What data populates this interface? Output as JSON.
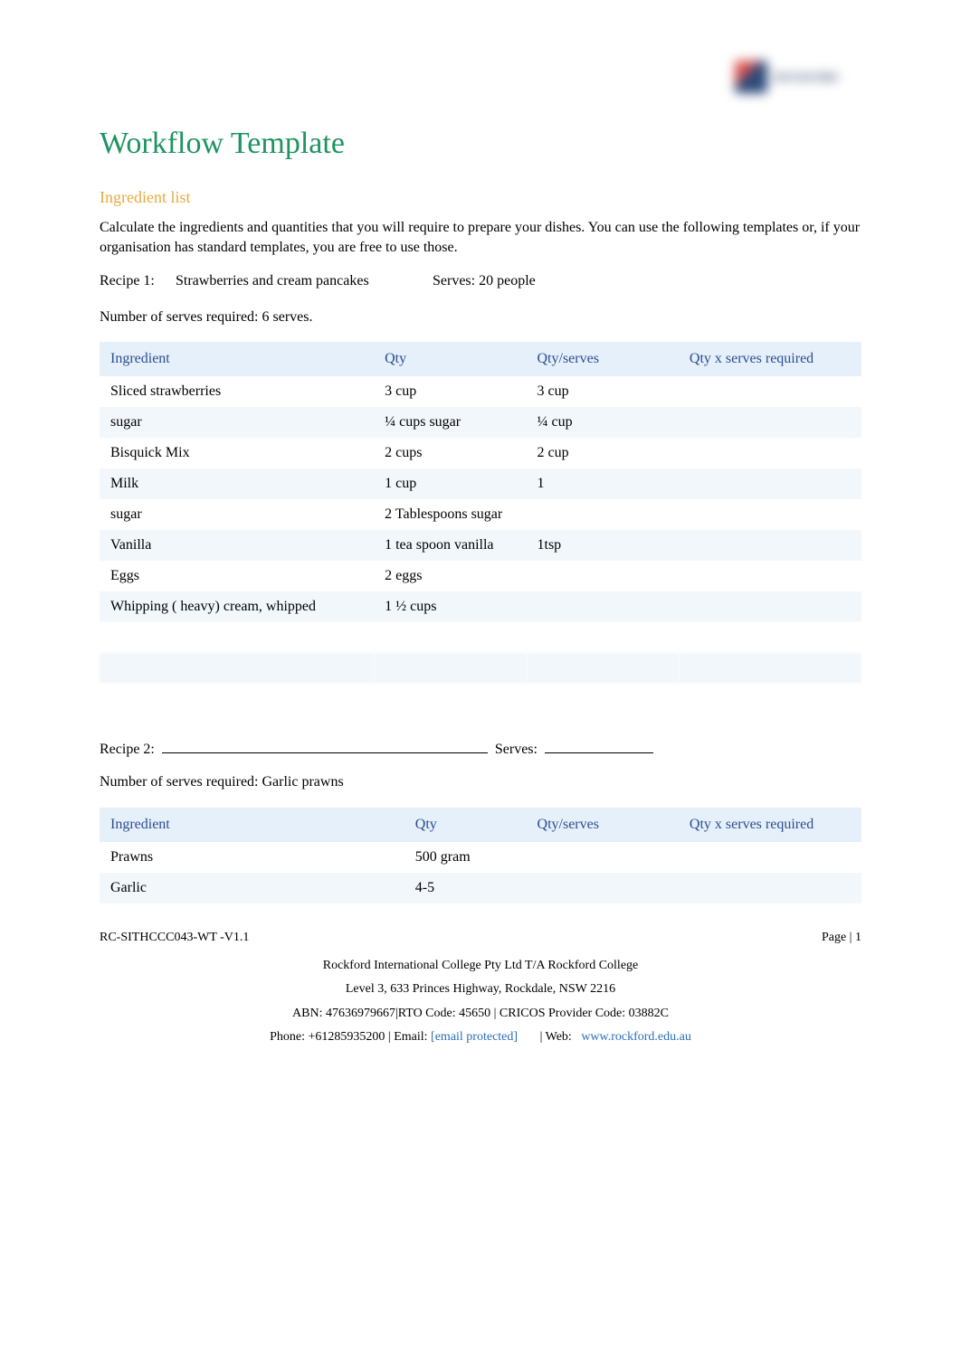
{
  "logo": {
    "alt": "Rockford logo"
  },
  "title": "Workflow Template",
  "section1": {
    "heading": "Ingredient list",
    "intro": "Calculate the ingredients and quantities that you will require to prepare your dishes. You can use the following templates or, if your organisation has standard templates, you are free to use those."
  },
  "recipe1": {
    "label": "Recipe 1:",
    "name": "Strawberries and cream pancakes",
    "serves_label": "Serves:",
    "serves_value": "20 people",
    "numserves_label": "Number of serves required:",
    "numserves_value": "6 serves."
  },
  "table1": {
    "headers": {
      "c1": "Ingredient",
      "c2": "Qty",
      "c3": "Qty/serves",
      "c4": "Qty x serves required"
    },
    "rows": [
      {
        "ingredient": "Sliced strawberries",
        "qty": "3 cup",
        "qtyserves": "3 cup",
        "req": ""
      },
      {
        "ingredient": "sugar",
        "qty": "¼ cups sugar",
        "qtyserves": "¼ cup",
        "req": ""
      },
      {
        "ingredient": "Bisquick Mix",
        "qty": "2 cups",
        "qtyserves": "2 cup",
        "req": ""
      },
      {
        "ingredient": "Milk",
        "qty": "1 cup",
        "qtyserves": "1",
        "req": ""
      },
      {
        "ingredient": "sugar",
        "qty": "2 Tablespoons sugar",
        "qtyserves": "",
        "req": ""
      },
      {
        "ingredient": "Vanilla",
        "qty": "1 tea spoon vanilla",
        "qtyserves": "1tsp",
        "req": ""
      },
      {
        "ingredient": "Eggs",
        "qty": "2 eggs",
        "qtyserves": "",
        "req": ""
      },
      {
        "ingredient": "Whipping ( heavy) cream, whipped",
        "qty": "1 ½ cups",
        "qtyserves": "",
        "req": ""
      }
    ]
  },
  "recipe2": {
    "label": "Recipe 2:",
    "name": "",
    "serves_label": "Serves:",
    "serves_value": "",
    "numserves_label": "Number of serves required:",
    "numserves_value": "Garlic prawns"
  },
  "table2": {
    "headers": {
      "c1": "Ingredient",
      "c2": "Qty",
      "c3": "Qty/serves",
      "c4": "Qty x serves required"
    },
    "rows": [
      {
        "ingredient": "Prawns",
        "qty": "500 gram",
        "qtyserves": "",
        "req": ""
      },
      {
        "ingredient": "Garlic",
        "qty": "4-5",
        "qtyserves": "",
        "req": ""
      }
    ]
  },
  "footer": {
    "code": "RC-SITHCCC043-WT -V1.1",
    "page": "Page | 1",
    "line1": "Rockford International College Pty Ltd T/A Rockford College",
    "line2": "Level 3, 633 Princes Highway, Rockdale, NSW 2216",
    "line3": "ABN: 47636979667|RTO Code: 45650 | CRICOS Provider Code: 03882C",
    "phone_label": "Phone: +61285935200 | Email:",
    "email_text": "[email protected]",
    "web_sep": "| Web:",
    "web_text": "www.rockford.edu.au"
  }
}
